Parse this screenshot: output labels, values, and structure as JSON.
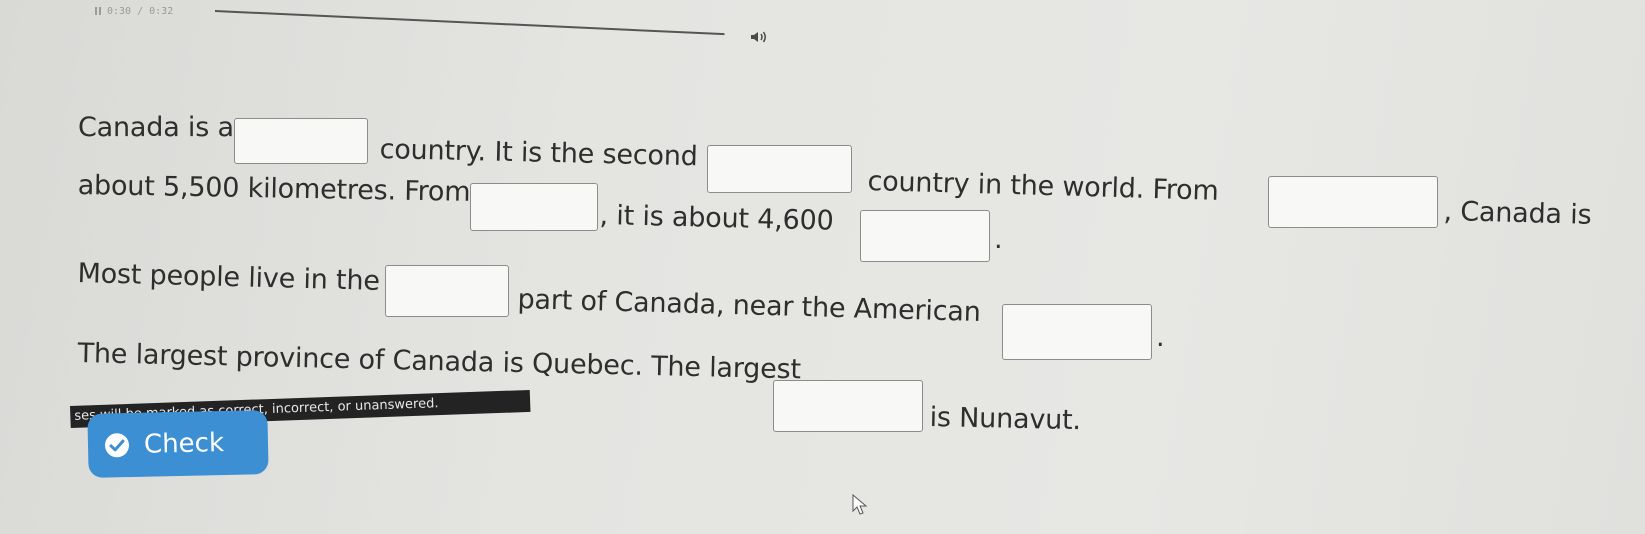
{
  "player": {
    "time": "0:30 / 0:32"
  },
  "passage": {
    "s1_a": "Canada is a",
    "s1_b": "country. It is the second",
    "s1_c": "country in the world. From",
    "s1_d": ", Canada is",
    "s2_a": "about 5,500 kilometres. From",
    "s2_b": ", it is about 4,600",
    "s2_c": ".",
    "s3_a": "Most people live in the",
    "s3_b": "part of Canada, near the American",
    "s3_c": ".",
    "s4_a": "The largest province of Canada is Quebec. The largest",
    "s4_b": "is Nunavut."
  },
  "tooltip": {
    "text": "ses will be marked as correct, incorrect, or unanswered."
  },
  "check_button": {
    "label": "Check"
  },
  "colors": {
    "accent": "#3c8fd3",
    "text": "#2e2e2e",
    "blank_fill": "#f8f8f6",
    "blank_border": "#8c8c8c",
    "tooltip_bg": "#232323"
  },
  "icons": [
    "pause-icon",
    "volume-icon",
    "check-circle-icon",
    "cursor-icon"
  ]
}
